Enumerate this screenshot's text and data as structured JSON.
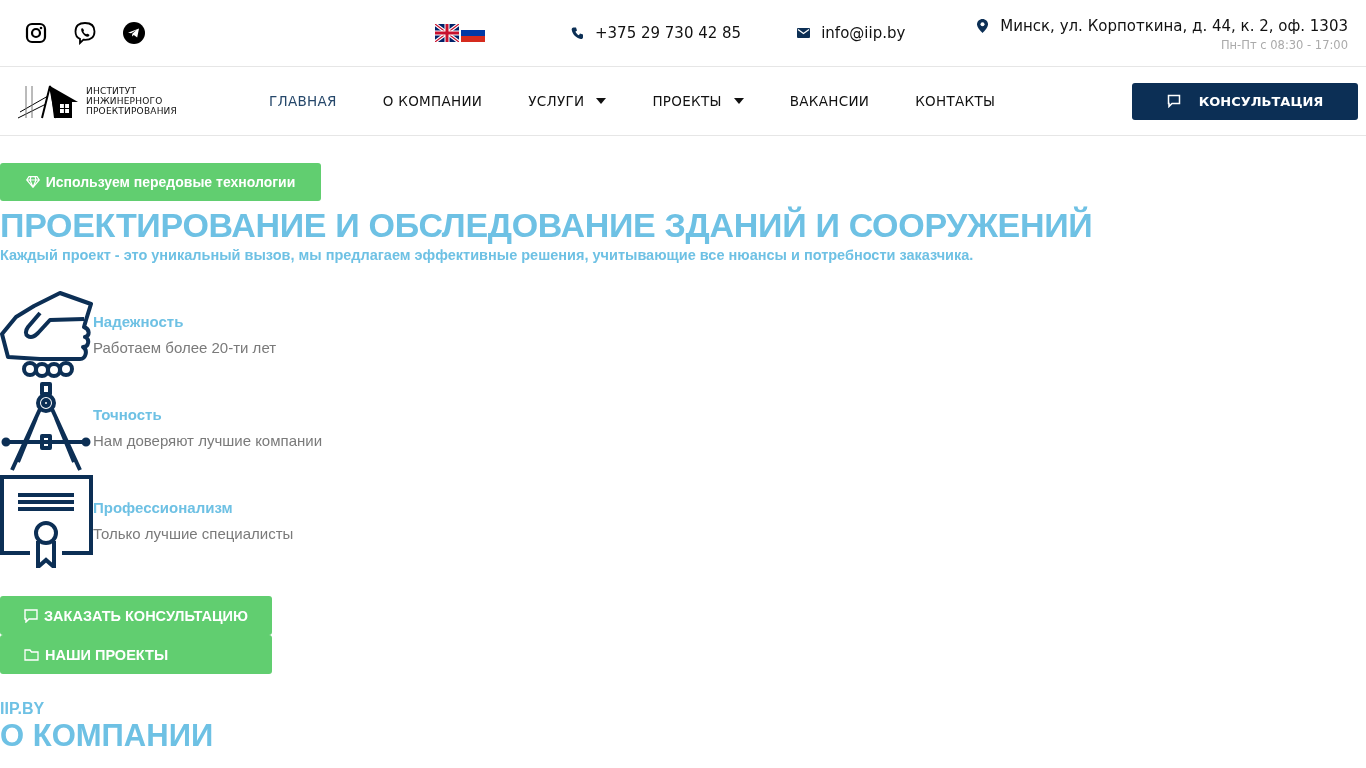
{
  "topbar": {
    "phone": "+375 29 730 42 85",
    "email": "info@iip.by",
    "address": "Минск, ул. Корпоткина, д. 44, к. 2, оф. 1303",
    "hours": "Пн-Пт с 08:30 - 17:00"
  },
  "logo": {
    "lines": [
      "ИНСТИТУТ",
      "ИНЖИНЕРНОГО",
      "ПРОЕКТИРОВАНИЯ"
    ]
  },
  "nav": [
    {
      "label": "ГЛАВНАЯ",
      "selected": true,
      "dropdown": false
    },
    {
      "label": "О КОМПАНИИ",
      "selected": false,
      "dropdown": false
    },
    {
      "label": "УСЛУГИ",
      "selected": false,
      "dropdown": true
    },
    {
      "label": "ПРОЕКТЫ",
      "selected": false,
      "dropdown": true
    },
    {
      "label": "ВАКАНСИИ",
      "selected": false,
      "dropdown": false
    },
    {
      "label": "КОНТАКТЫ",
      "selected": false,
      "dropdown": false
    }
  ],
  "cta": "КОНСУЛЬТАЦИЯ",
  "hero": {
    "badge": "Используем передовые технологии",
    "title": "ПРОЕКТИРОВАНИЕ И ОБСЛЕДОВАНИЕ ЗДАНИЙ И СООРУЖЕНИЙ",
    "subtitle": "Каждый проект - это уникальный вызов, мы предлагаем эффективные решения, учитывающие все нюансы и потребности заказчика."
  },
  "features": [
    {
      "kind": "hand",
      "title": "Надежность",
      "text": "Работаем более 20-ти лет"
    },
    {
      "kind": "compass",
      "title": "Точность",
      "text": "Нам доверяют лучшие компании"
    },
    {
      "kind": "certificate",
      "title": "Профессионализм",
      "text": "Только лучшие специалисты"
    }
  ],
  "buttons": [
    {
      "kind": "chat",
      "label": "ЗАКАЗАТЬ КОНСУЛЬТАЦИЮ"
    },
    {
      "kind": "folder",
      "label": "НАШИ ПРОЕКТЫ"
    }
  ],
  "about": {
    "eyebrow": "IIP.BY",
    "title": "О КОМПАНИИ"
  }
}
